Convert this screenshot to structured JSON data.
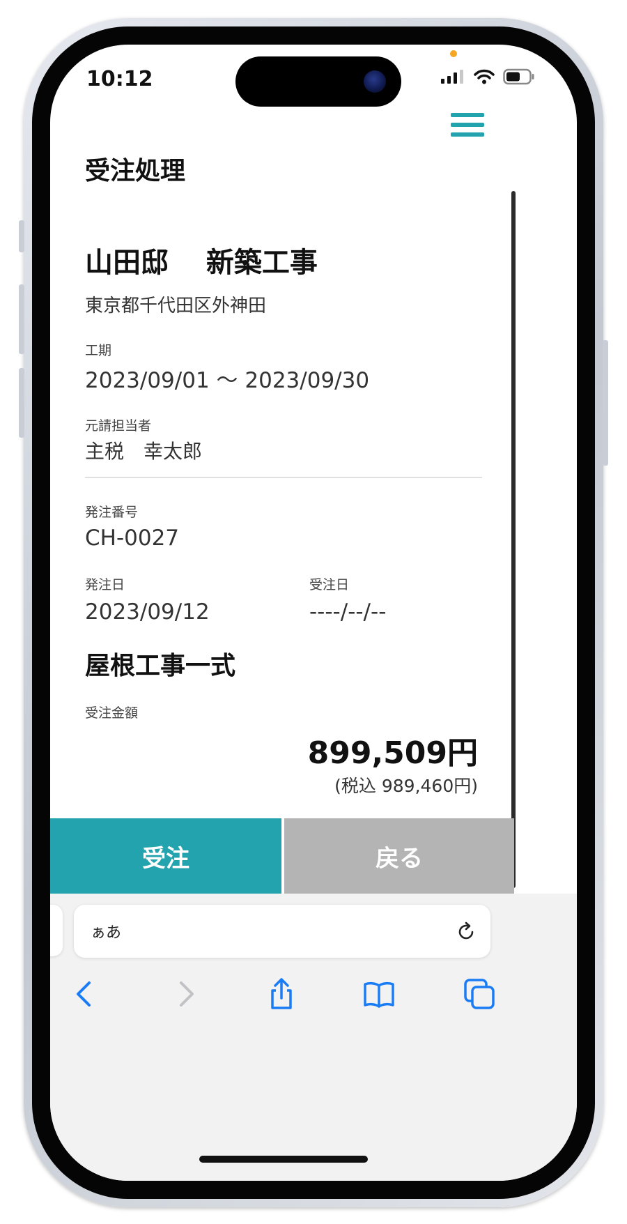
{
  "status_bar": {
    "time": "10:12"
  },
  "header": {
    "menu_icon": "hamburger-menu-icon",
    "page_title": "受注処理"
  },
  "project": {
    "name": "山田邸　 新築工事",
    "address": "東京都千代田区外神田",
    "period_label": "工期",
    "period_value": "2023/09/01 ～ 2023/09/30",
    "manager_label": "元請担当者",
    "manager_value": "主税　幸太郎"
  },
  "order": {
    "number_label": "発注番号",
    "number_value": "CH-0027",
    "order_date_label": "発注日",
    "order_date_value": "2023/09/12",
    "accept_date_label": "受注日",
    "accept_date_value": "----/--/--",
    "item_name": "屋根工事一式",
    "amount_label": "受注金額",
    "amount_value": "899,509円",
    "amount_tax": "(税込 989,460円)"
  },
  "actions": {
    "accept_label": "受注",
    "back_label": "戻る"
  },
  "browser": {
    "url_text": "ぁあ",
    "icons": [
      "reload-icon",
      "back-arrow-icon",
      "forward-arrow-icon",
      "share-icon",
      "bookmarks-icon",
      "tabs-icon"
    ]
  },
  "colors": {
    "accent": "#23a3ad",
    "disabled_button": "#b4b4b4",
    "ios_blue": "#1a7cf5"
  }
}
